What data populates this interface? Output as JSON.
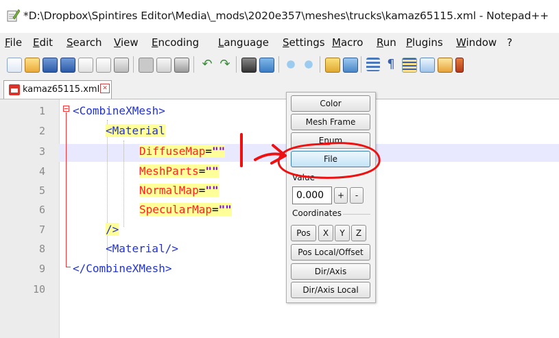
{
  "window": {
    "title": "*D:\\Dropbox\\Spintires Editor\\Media\\_mods\\2020e357\\meshes\\trucks\\kamaz65115.xml - Notepad++",
    "icon": "notepadpp-icon"
  },
  "menu": [
    "File",
    "Edit",
    "Search",
    "View",
    "Encoding",
    "Language",
    "Settings",
    "Macro",
    "Run",
    "Plugins",
    "Window",
    "?"
  ],
  "toolbar": {
    "icons": [
      "new-file-icon",
      "open-file-icon",
      "save-icon",
      "save-all-icon",
      "close-icon",
      "close-all-icon",
      "print-icon",
      "cut-icon",
      "copy-icon",
      "paste-icon",
      "undo-icon",
      "redo-icon",
      "find-icon",
      "replace-icon",
      "zoom-in-icon",
      "zoom-out-icon",
      "sync-vertical-icon",
      "sync-horizontal-icon",
      "word-wrap-icon",
      "show-all-chars-icon",
      "indent-guide-icon",
      "user-language-icon",
      "doc-map-icon"
    ]
  },
  "tab": {
    "label": "kamaz65115.xml",
    "icon": "unsaved-file-icon",
    "close_icon": "tab-close-icon"
  },
  "editor": {
    "line_numbers": [
      "1",
      "2",
      "3",
      "4",
      "5",
      "6",
      "7",
      "8",
      "9",
      "10"
    ],
    "current_line": 3,
    "lines": {
      "l1": "<CombineXMesh>",
      "l2": "<Material",
      "l3_attr": "DiffuseMap",
      "l4_attr": "MeshParts",
      "l5_attr": "NormalMap",
      "l6_attr": "SpecularMap",
      "eq": "=",
      "quote": "\"\"",
      "l7": "/>",
      "l8": "<Material/>",
      "l9": "</CombineXMesh>"
    },
    "colors": {
      "tag": "#2233cc",
      "attribute": "#ff2222",
      "string": "#8000ff",
      "fold_marker": "#ff3333"
    }
  },
  "panel": {
    "buttons": {
      "color": "Color",
      "mesh_frame": "Mesh Frame",
      "enum": "Enum",
      "file": "File"
    },
    "value_label": "Value",
    "value": "0.000",
    "plus": "+",
    "minus": "-",
    "coordinates_label": "Coordinates",
    "pos": "Pos",
    "x": "X",
    "y": "Y",
    "z": "Z",
    "pos_local_offset": "Pos Local/Offset",
    "dir_axis": "Dir/Axis",
    "dir_axis_local": "Dir/Axis Local"
  },
  "annotation": {
    "color": "#ee1111",
    "description_icons": [
      "cursor-marker",
      "arrow-icon",
      "circle-highlight"
    ]
  }
}
